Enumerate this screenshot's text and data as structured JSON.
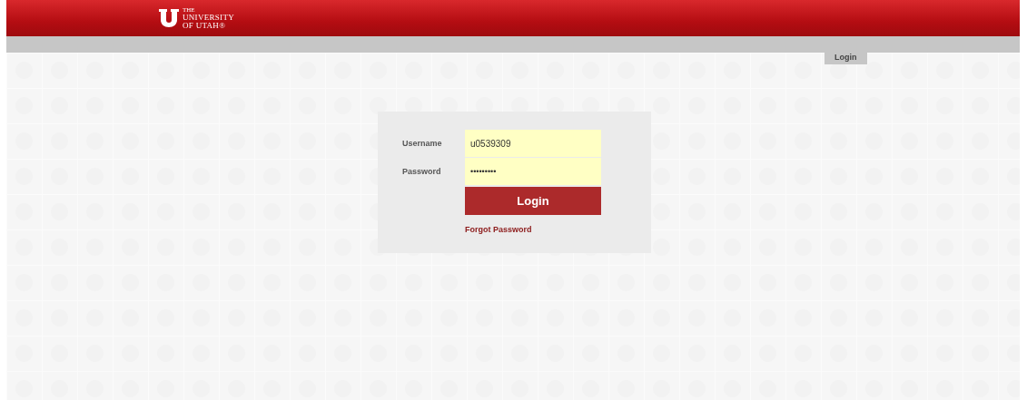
{
  "header": {
    "logo": {
      "small": "THE",
      "line1": "UNIVERSITY",
      "line2": "OF UTAH®"
    }
  },
  "nav": {
    "tabs": [
      {
        "label": "Login",
        "selected": true
      }
    ]
  },
  "login_form": {
    "username": {
      "label": "Username",
      "value": "u0539309"
    },
    "password": {
      "label": "Password",
      "value": "•••••••••"
    },
    "submit": "Login",
    "forgot_link": "Forgot Password"
  }
}
